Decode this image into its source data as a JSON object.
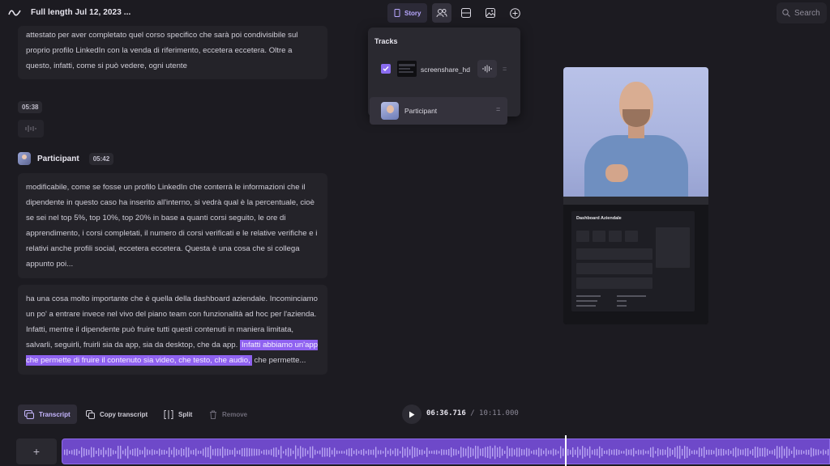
{
  "header": {
    "doc_title": "Full length Jul 12, 2023 ...",
    "story_label": "Story",
    "search_label": "Search"
  },
  "transcript": {
    "block1": "attestato per aver completato quel corso specifico che sarà poi condivisibile sul proprio profilo LinkedIn con la venda di riferimento, eccetera eccetera. Oltre a questo, infatti, come si può vedere, ogni utente",
    "silence_timestamp": "05:38",
    "speaker_name": "Participant",
    "speaker_timestamp": "05:42",
    "block2": "modificabile, come se fosse un profilo LinkedIn che conterrà le informazioni che il dipendente in questo caso ha inserito all'interno, si vedrà qual è la percentuale, cioè se sei nel top 5%, top 10%, top 20% in base a quanti corsi seguito, le ore di apprendimento, i corsi completati, il numero di corsi verificati e le relative verifiche e i relativi anche profili social, eccetera eccetera. Questa è una cosa che si collega appunto poi...",
    "block3_before": "ha una cosa molto importante che è quella della dashboard aziendale. Incominciamo un po' a entrare invece nel vivo del piano team con funzionalità ad hoc per l'azienda. Infatti, mentre il dipendente può fruire tutti questi contenuti in maniera limitata, salvarli, seguirli, fruirli sia da app, sia da desktop, che da app. ",
    "block3_highlight": "Infatti abbiamo un'app che permette di fruire il contenuto sia video, che testo, che audio,",
    "block3_after": " che permette..."
  },
  "tracks": {
    "title": "Tracks",
    "items": [
      {
        "label": "screenshare_hd",
        "checked": true
      },
      {
        "label": "Participant",
        "checked": false
      }
    ]
  },
  "preview": {
    "dashboard_title": "Dashboard Aziendale"
  },
  "toolbar": {
    "transcript_label": "Transcript",
    "copy_label": "Copy transcript",
    "split_label": "Split",
    "remove_label": "Remove",
    "current_time": "06:36.716",
    "separator": "/",
    "duration": "10:11.000"
  },
  "timeline": {
    "add_label": "+",
    "playhead_fraction": 0.655
  },
  "colors": {
    "accent": "#8a6cf0",
    "highlight": "#8f62f0",
    "waveform": "#6e49c9",
    "background": "#1c1b21"
  }
}
